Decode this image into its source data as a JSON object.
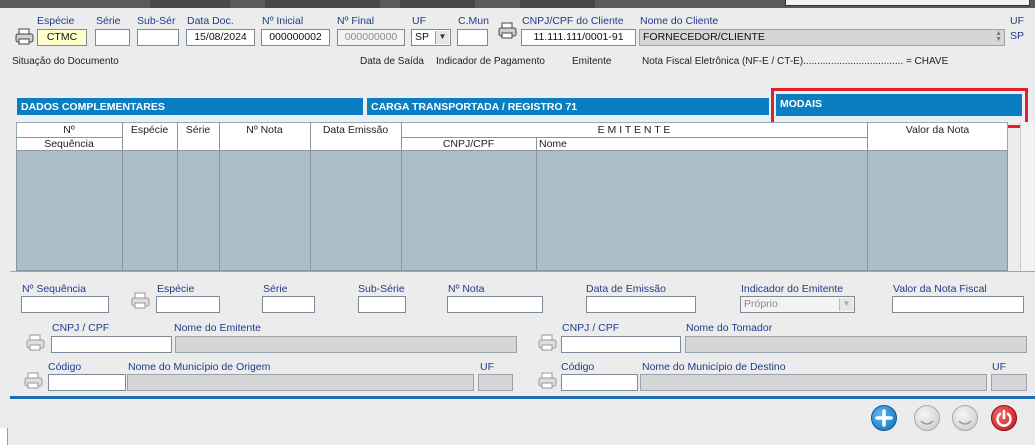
{
  "top_bar": {
    "values": [
      "",
      "",
      "",
      "",
      ""
    ]
  },
  "header": {
    "especie_label": "Espécie",
    "especie_value": "CTMC",
    "serie_label": "Série",
    "serie_value": "",
    "subser_label": "Sub-Sér",
    "subser_value": "",
    "data_doc_label": "Data Doc.",
    "data_doc_value": "15/08/2024",
    "n_inicial_label": "Nº Inicial",
    "n_inicial_value": "000000002",
    "n_final_label": "Nº Final",
    "n_final_value": "000000000",
    "uf_label": "UF",
    "uf_value": "SP",
    "cmun_label": "C.Mun",
    "cmun_value": "",
    "cnpj_label": "CNPJ/CPF do Cliente",
    "cnpj_value": "11.111.111/0001-91",
    "nome_cliente_label": "Nome do Cliente",
    "nome_cliente_value": "FORNECEDOR/CLIENTE",
    "uf2_label": "UF",
    "uf2_value": "SP"
  },
  "status_row": {
    "situacao": "Situação do Documento",
    "data_saida": "Data de Saída",
    "indicador_pagamento": "Indicador de Pagamento",
    "emitente": "Emitente",
    "nfe": "Nota Fiscal Eletrônica (NF-E / CT-E)....................................  =  CHAVE"
  },
  "tabs": {
    "dados": "DADOS COMPLEMENTARES",
    "carga": "CARGA TRANSPORTADA / REGISTRO 71",
    "modais": "MODAIS"
  },
  "grid": {
    "col_n": "Nº",
    "col_sequencia": "Sequência",
    "col_especie": "Espécie",
    "col_serie": "Série",
    "col_nota": "Nº Nota",
    "col_data": "Data Emissão",
    "col_emitente": "E M I T E N T E",
    "col_cnpj": "CNPJ/CPF",
    "col_nome": "Nome",
    "col_valor": "Valor da Nota"
  },
  "form": {
    "n_sequencia": "Nº Sequência",
    "especie": "Espécie",
    "serie": "Série",
    "sub_serie": "Sub-Série",
    "n_nota": "Nº Nota",
    "data_emissao": "Data de Emissão",
    "indicador_emitente": "Indicador do Emitente",
    "indicador_value": "Próprio",
    "valor_nota": "Valor da Nota Fiscal",
    "cnpj_emitente": "CNPJ / CPF",
    "nome_emitente": "Nome do Emitente",
    "cnpj_tomador": "CNPJ / CPF",
    "nome_tomador": "Nome do Tomador",
    "codigo_origem": "Código",
    "municipio_origem": "Nome do Município de Origem",
    "uf_origem": "UF",
    "codigo_destino": "Código",
    "municipio_destino": "Nome do Município de Destino",
    "uf_destino": "UF"
  },
  "icons": {
    "add": "plus-icon",
    "disabled1": "disabled-icon",
    "disabled2": "disabled-icon",
    "exit": "power-icon"
  },
  "colors": {
    "tab": "#0b7ec2",
    "grid_body": "#a9bec9",
    "highlight": "#e0212b"
  }
}
